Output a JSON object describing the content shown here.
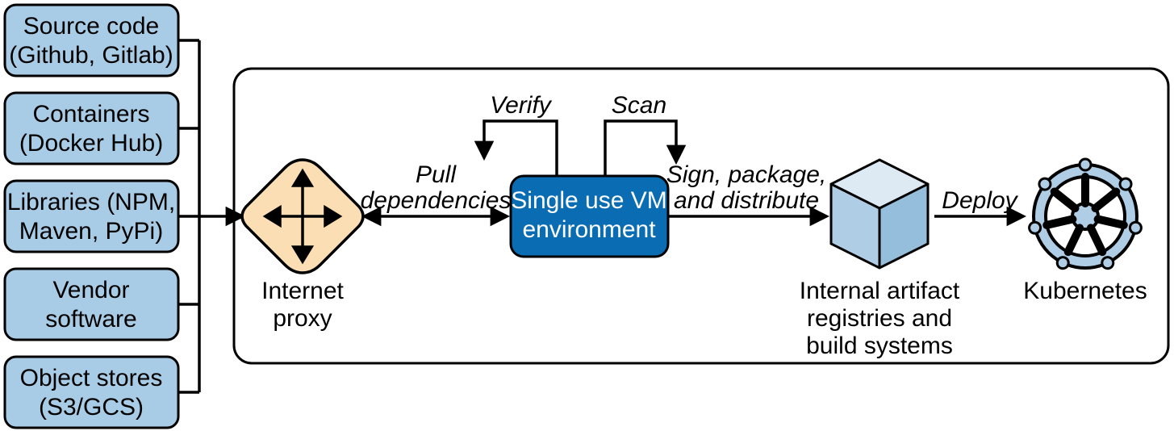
{
  "sources": [
    {
      "line1": "Source code",
      "line2": "(Github, Gitlab)"
    },
    {
      "line1": "Containers",
      "line2": "(Docker Hub)"
    },
    {
      "line1": "Libraries (NPM,",
      "line2": "Maven, PyPi)"
    },
    {
      "line1": "Vendor",
      "line2": "software"
    },
    {
      "line1": "Object stores",
      "line2": "(S3/GCS)"
    }
  ],
  "proxy_label": "Internet",
  "proxy_label2": "proxy",
  "pull_label1": "Pull",
  "pull_label2": "dependencies",
  "verify_label": "Verify",
  "scan_label": "Scan",
  "vm_label1": "Single use VM",
  "vm_label2": "environment",
  "sign_label1": "Sign, package,",
  "sign_label2": "and distribute",
  "registry_label1": "Internal artifact",
  "registry_label2": "registries and",
  "registry_label3": "build systems",
  "deploy_label": "Deploy",
  "k8s_label": "Kubernetes"
}
